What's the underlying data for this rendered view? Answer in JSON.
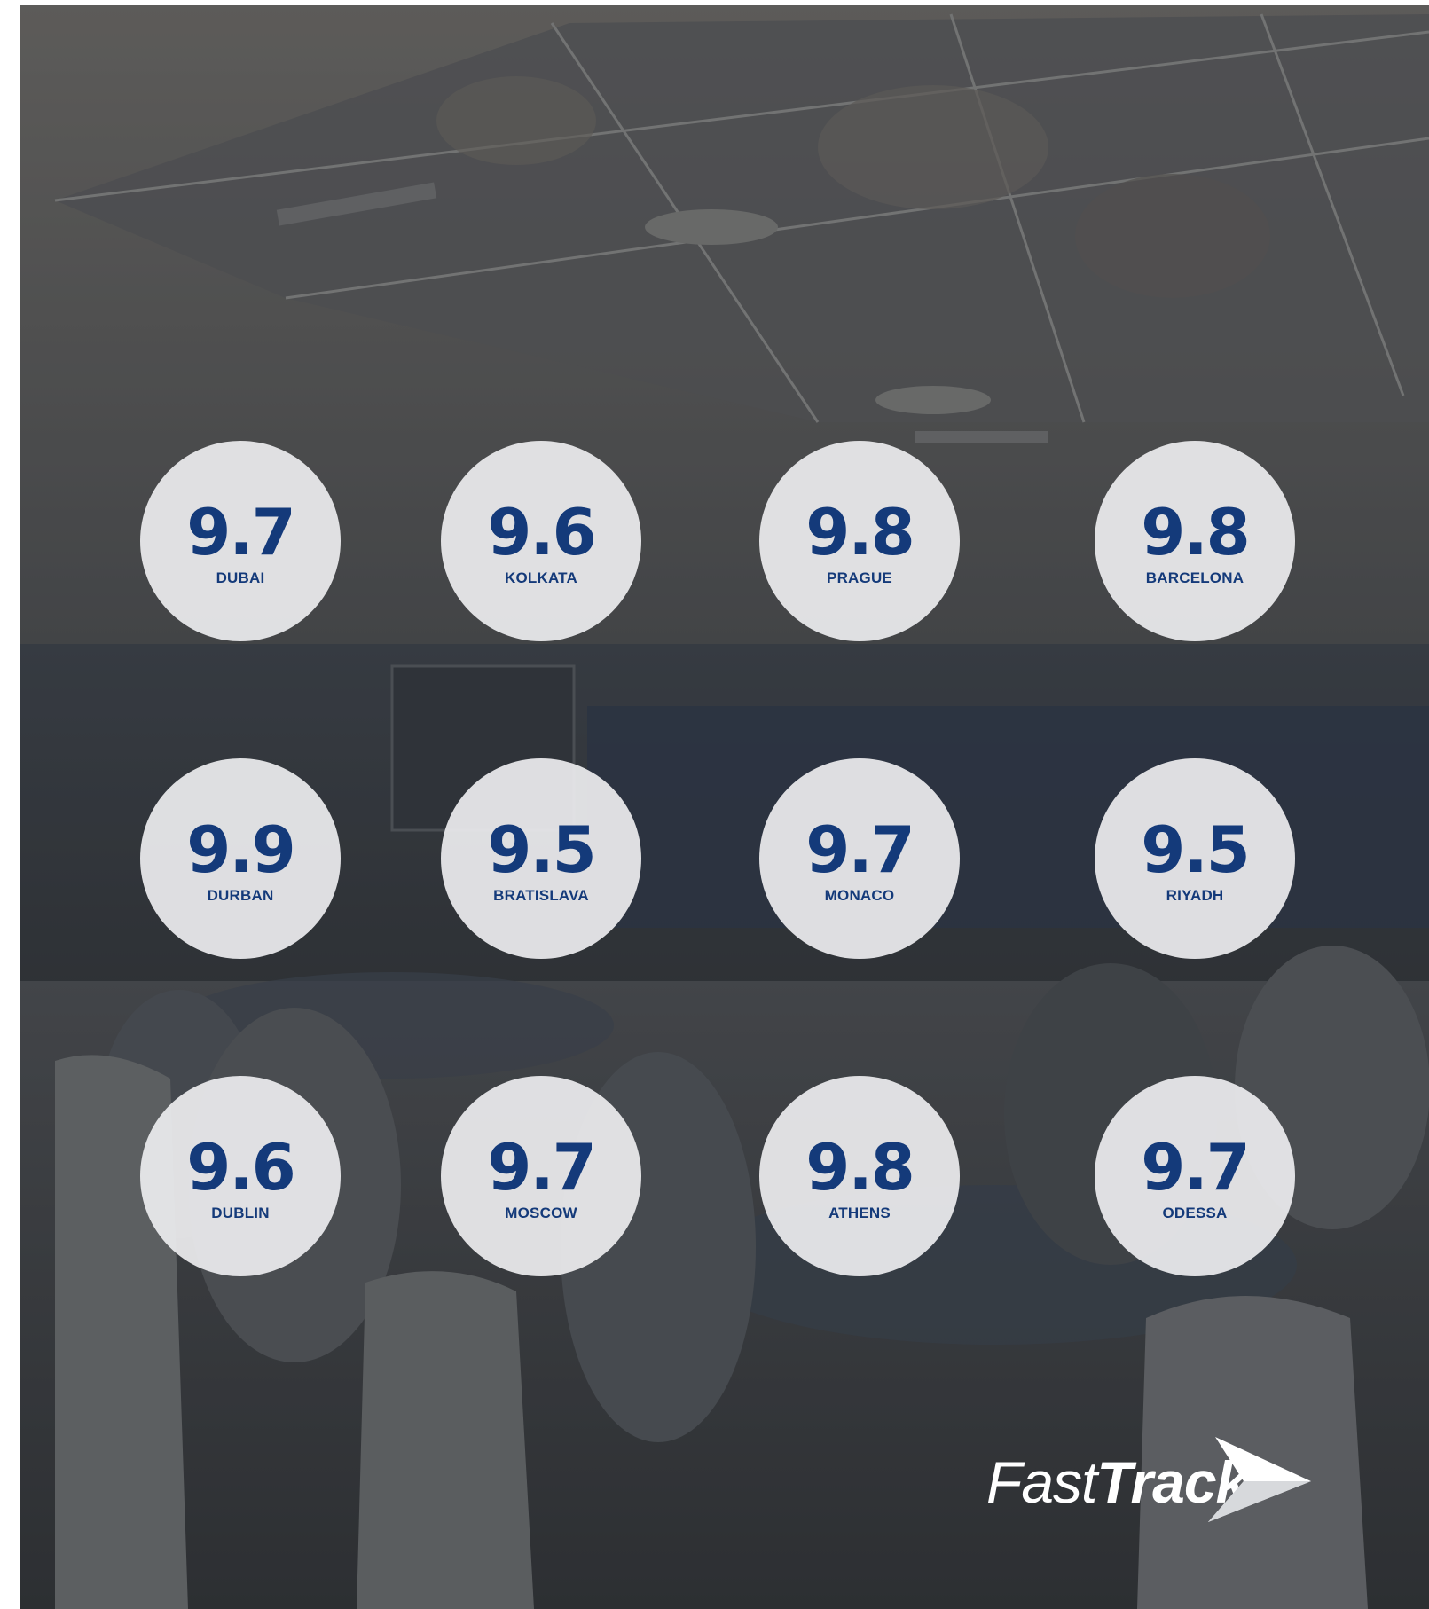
{
  "brand": {
    "logo_part1": "Fast",
    "logo_part2": "Track"
  },
  "scores": [
    {
      "value": "9.7",
      "city": "DUBAI"
    },
    {
      "value": "9.6",
      "city": "KOLKATA"
    },
    {
      "value": "9.8",
      "city": "PRAGUE"
    },
    {
      "value": "9.8",
      "city": "BARCELONA"
    },
    {
      "value": "9.9",
      "city": "DURBAN"
    },
    {
      "value": "9.5",
      "city": "BRATISLAVA"
    },
    {
      "value": "9.7",
      "city": "MONACO"
    },
    {
      "value": "9.5",
      "city": "RIYADH"
    },
    {
      "value": "9.6",
      "city": "DUBLIN"
    },
    {
      "value": "9.7",
      "city": "MOSCOW"
    },
    {
      "value": "9.8",
      "city": "ATHENS"
    },
    {
      "value": "9.7",
      "city": "ODESSA"
    }
  ],
  "colors": {
    "badge_text": "#143a7a",
    "badge_fill": "#ececee",
    "overlay": "#3b3e42",
    "logo": "#ffffff"
  }
}
